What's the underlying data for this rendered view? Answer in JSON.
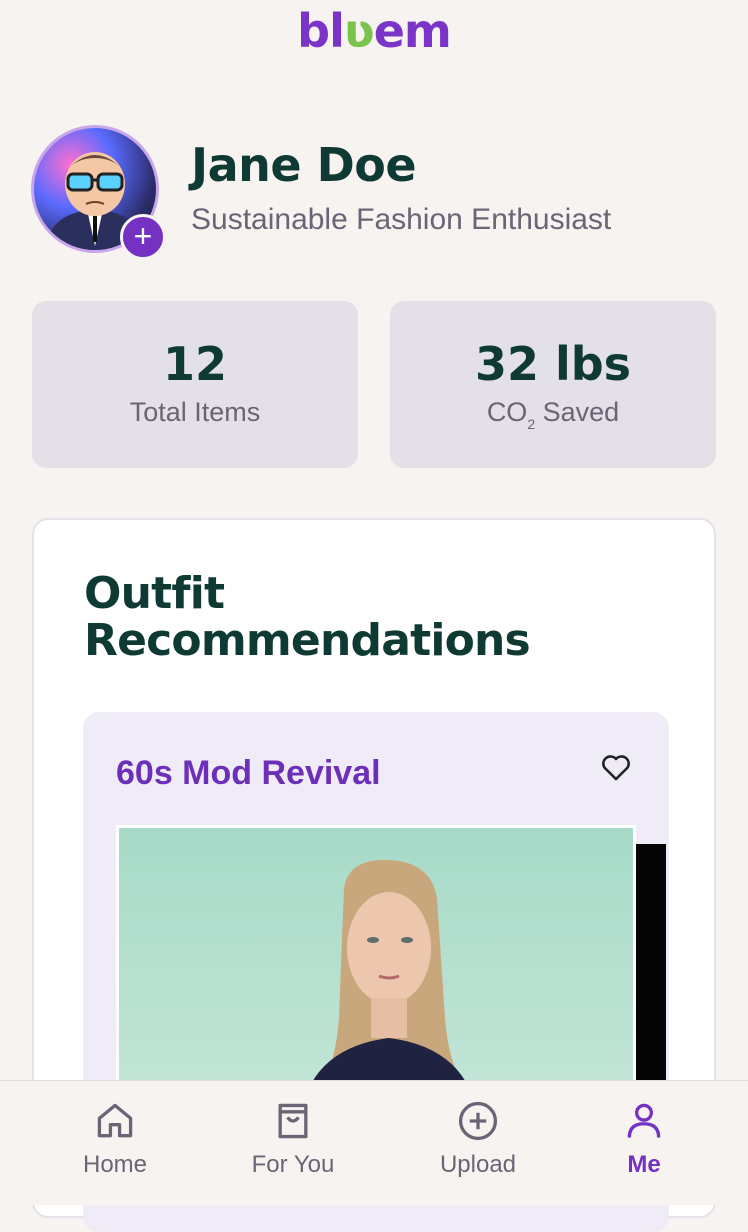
{
  "app": {
    "logo_text_a": "bl",
    "logo_text_b": "em"
  },
  "profile": {
    "name": "Jane Doe",
    "tagline": "Sustainable Fashion Enthusiast",
    "add_label": "+"
  },
  "stats": [
    {
      "value": "12",
      "label": "Total Items"
    },
    {
      "value": "32 lbs",
      "label_prefix": "CO",
      "label_sub": "2",
      "label_suffix": " Saved"
    }
  ],
  "recommendations": {
    "title": "Outfit Recommendations",
    "outfit": {
      "name": "60s Mod Revival"
    }
  },
  "nav": [
    {
      "label": "Home",
      "icon": "home-icon"
    },
    {
      "label": "For You",
      "icon": "bag-icon"
    },
    {
      "label": "Upload",
      "icon": "plus-circle-icon"
    },
    {
      "label": "Me",
      "icon": "user-icon",
      "active": true
    }
  ],
  "colors": {
    "accent": "#7431c2",
    "heading": "#0f3a33",
    "background": "#f7f3f1"
  }
}
